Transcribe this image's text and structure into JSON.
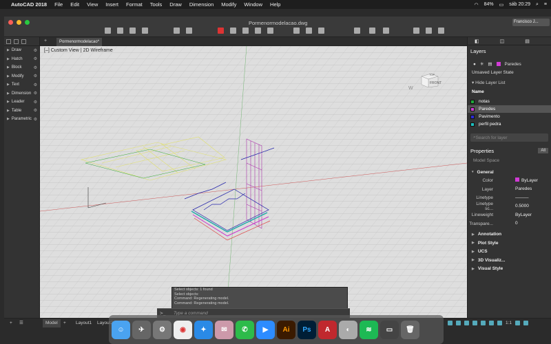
{
  "menubar": {
    "app": "AutoCAD 2018",
    "items": [
      "File",
      "Edit",
      "View",
      "Insert",
      "Format",
      "Tools",
      "Draw",
      "Dimension",
      "Modify",
      "Window",
      "Help"
    ],
    "battery": "84%",
    "clock": "sáb 20:29"
  },
  "window": {
    "doc_title": "Pormenormodelacao.dwg",
    "user": "Francisco J..."
  },
  "tabs": {
    "active": "Pormenormodelacao*"
  },
  "viewport": {
    "label_prefix": "[–]",
    "view": "Custom View",
    "style": "2D Wireframe",
    "viewcube_top": "TOP",
    "viewcube_front": "FRONT",
    "viewcube_w": "W"
  },
  "left_palette": {
    "items": [
      "Draw",
      "Hatch",
      "Block",
      "Modify",
      "Text",
      "Dimension",
      "Leader",
      "Table",
      "Parametric"
    ]
  },
  "layers": {
    "title": "Layers",
    "current": "Paredes",
    "state": "Unsaved Layer State",
    "hide_label": "Hide Layer List",
    "name_header": "Name",
    "list": [
      {
        "name": "notas",
        "color": "#1faa3a"
      },
      {
        "name": "Paredes",
        "color": "#d23bd6"
      },
      {
        "name": "Pavimento",
        "color": "#2b2bd8"
      },
      {
        "name": "perfil pedra",
        "color": "#1fbfbf"
      }
    ],
    "search_placeholder": "Search for layer"
  },
  "properties": {
    "title": "Properties",
    "filter_all": "All",
    "space": "Model Space",
    "general": "General",
    "rows": [
      {
        "label": "Color",
        "value": "ByLayer"
      },
      {
        "label": "Layer",
        "value": "Paredes"
      },
      {
        "label": "Linetype",
        "value": "———"
      },
      {
        "label": "Linetype sc...",
        "value": "0.5000"
      },
      {
        "label": "Lineweight",
        "value": "ByLayer"
      },
      {
        "label": "Transpare...",
        "value": "0"
      }
    ],
    "sections": [
      "Annotation",
      "Plot Style",
      "UCS",
      "3D Visualiz...",
      "Visual Style"
    ]
  },
  "command": {
    "history": [
      "Select objects: 1 found",
      "Select objects:",
      "Command: Regenerating model.",
      "Command: Regenerating model."
    ],
    "prompt": "≻_",
    "placeholder": "Type a command"
  },
  "bottom": {
    "tabs": [
      "Model",
      "Layout1",
      "Layout2"
    ]
  },
  "dock": {
    "items": [
      "finder",
      "launchpad",
      "system-prefs",
      "chrome",
      "safari",
      "mail",
      "whatsapp",
      "zoom",
      "Ai",
      "Ps",
      "autocad",
      "pro",
      "spotify",
      "screenshot",
      "trash"
    ]
  },
  "zoom_scale": "1:1"
}
